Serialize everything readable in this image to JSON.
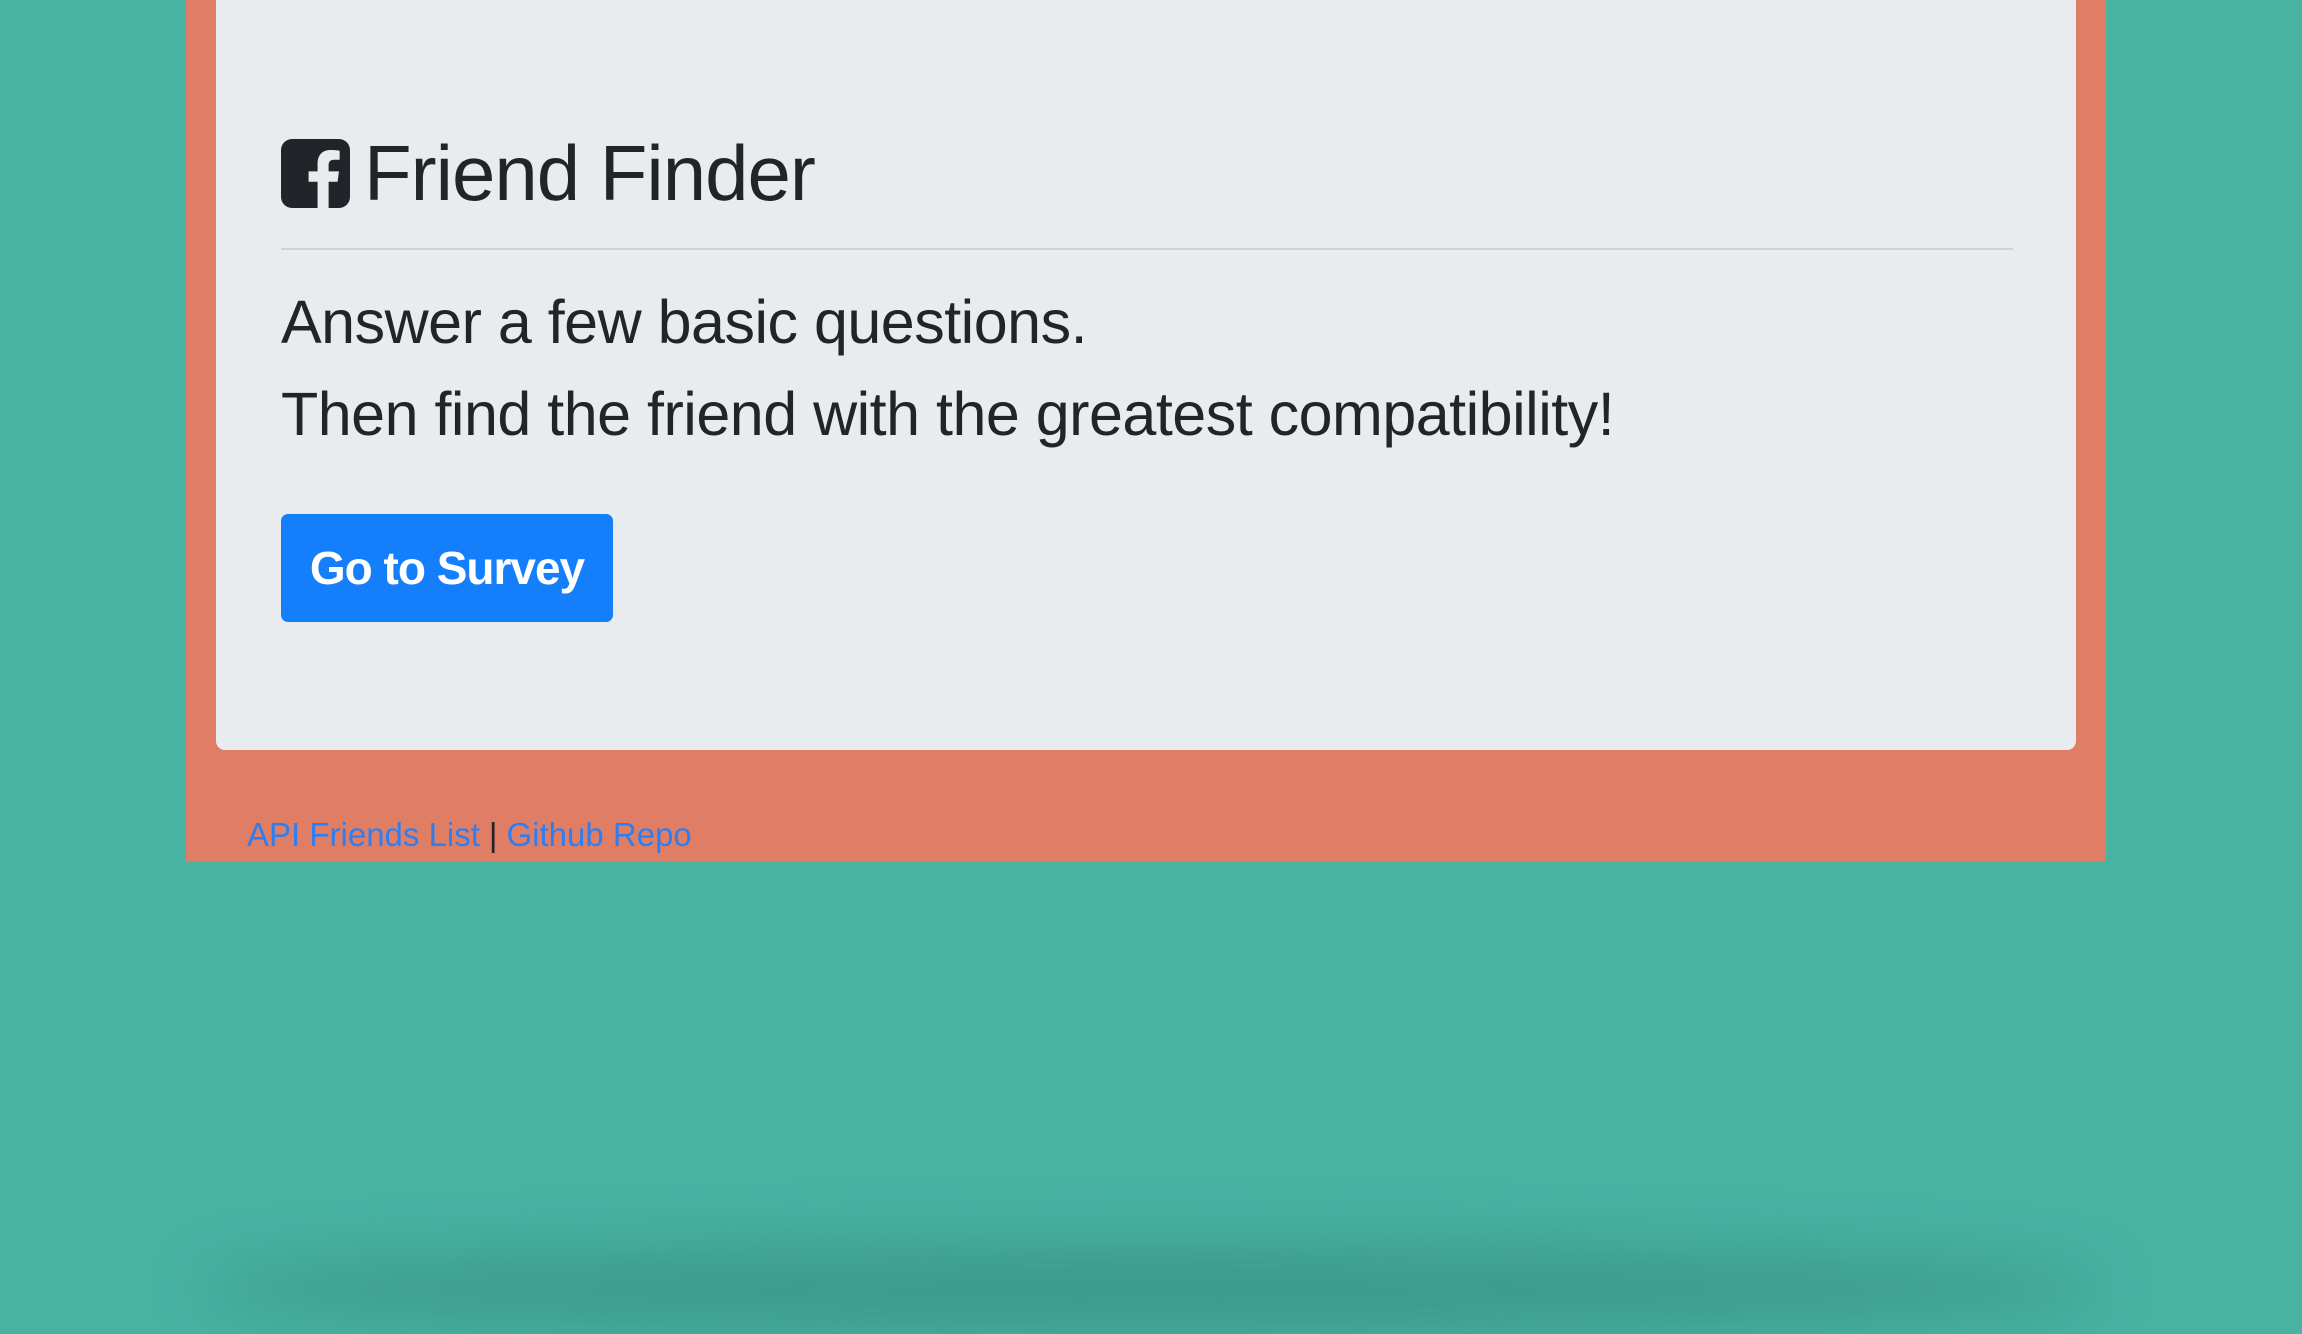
{
  "header": {
    "icon": "facebook-square-icon",
    "title": "Friend Finder"
  },
  "intro": {
    "line1": "Answer a few basic questions.",
    "line2": "Then find the friend with the greatest compatibility!"
  },
  "actions": {
    "survey_label": "Go to Survey"
  },
  "footer": {
    "api_link": "API Friends List",
    "separator": "|",
    "github_link": "Github Repo"
  },
  "colors": {
    "page_background": "#48b2a3",
    "container_background": "#e07e65",
    "jumbotron_background": "#e9ecef",
    "primary_button": "#157ffb",
    "link": "#2e7ef2",
    "text": "#212529"
  }
}
